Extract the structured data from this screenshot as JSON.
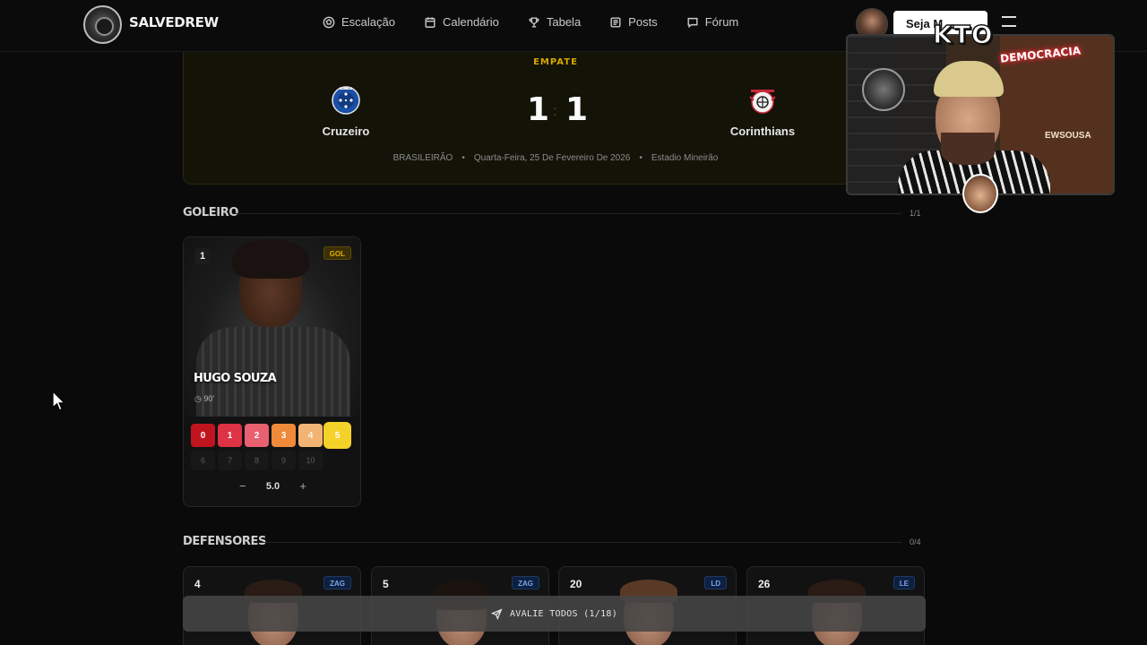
{
  "header": {
    "brand": "SALVEDREW",
    "nav": [
      {
        "label": "Escalação",
        "icon": "soccer-ball-icon"
      },
      {
        "label": "Calendário",
        "icon": "calendar-icon"
      },
      {
        "label": "Tabela",
        "icon": "trophy-icon"
      },
      {
        "label": "Posts",
        "icon": "newspaper-icon"
      },
      {
        "label": "Fórum",
        "icon": "chat-icon"
      }
    ],
    "cta_label": "Seja M"
  },
  "match": {
    "result_label": "EMPATE",
    "home_team": "Cruzeiro",
    "away_team": "Corinthians",
    "home_score": "1",
    "away_score": "1",
    "competition": "BRASILEIRÃO",
    "date": "Quarta-Feira, 25 De Fevereiro De 2026",
    "stadium": "Estadio Mineirão",
    "separator": "•"
  },
  "sections": {
    "goalkeepers": {
      "title": "GOLEIRO",
      "count": "1/1"
    },
    "defenders": {
      "title": "DEFENSORES",
      "count": "0/4"
    }
  },
  "goalkeeper": {
    "number": "1",
    "position": "GOL",
    "name": "HUGO SOUZA",
    "minutes": "90'",
    "ratings_row1": [
      "0",
      "1",
      "2",
      "3",
      "4",
      "5"
    ],
    "ratings_row2": [
      "6",
      "7",
      "8",
      "9",
      "10"
    ],
    "selected_rating": 5,
    "score": "5.0",
    "minus": "−",
    "plus": "+"
  },
  "defenders": [
    {
      "number": "4",
      "position": "ZAG"
    },
    {
      "number": "5",
      "position": "ZAG"
    },
    {
      "number": "20",
      "position": "LD"
    },
    {
      "number": "26",
      "position": "LE"
    }
  ],
  "rate_all_label": "AVALIE TODOS (1/18)",
  "webcam": {
    "sponsor": "KTO",
    "neon_sign": "DEMOCRACIA",
    "back_text": "EWSOUSA"
  },
  "colors": {
    "accent_gold": "#d4a900",
    "rate_0": "#c0141f",
    "rate_1": "#dd3344",
    "rate_2": "#e96070",
    "rate_3": "#ee8a3a",
    "rate_4": "#f2b474",
    "rate_5": "#f5d22a"
  }
}
